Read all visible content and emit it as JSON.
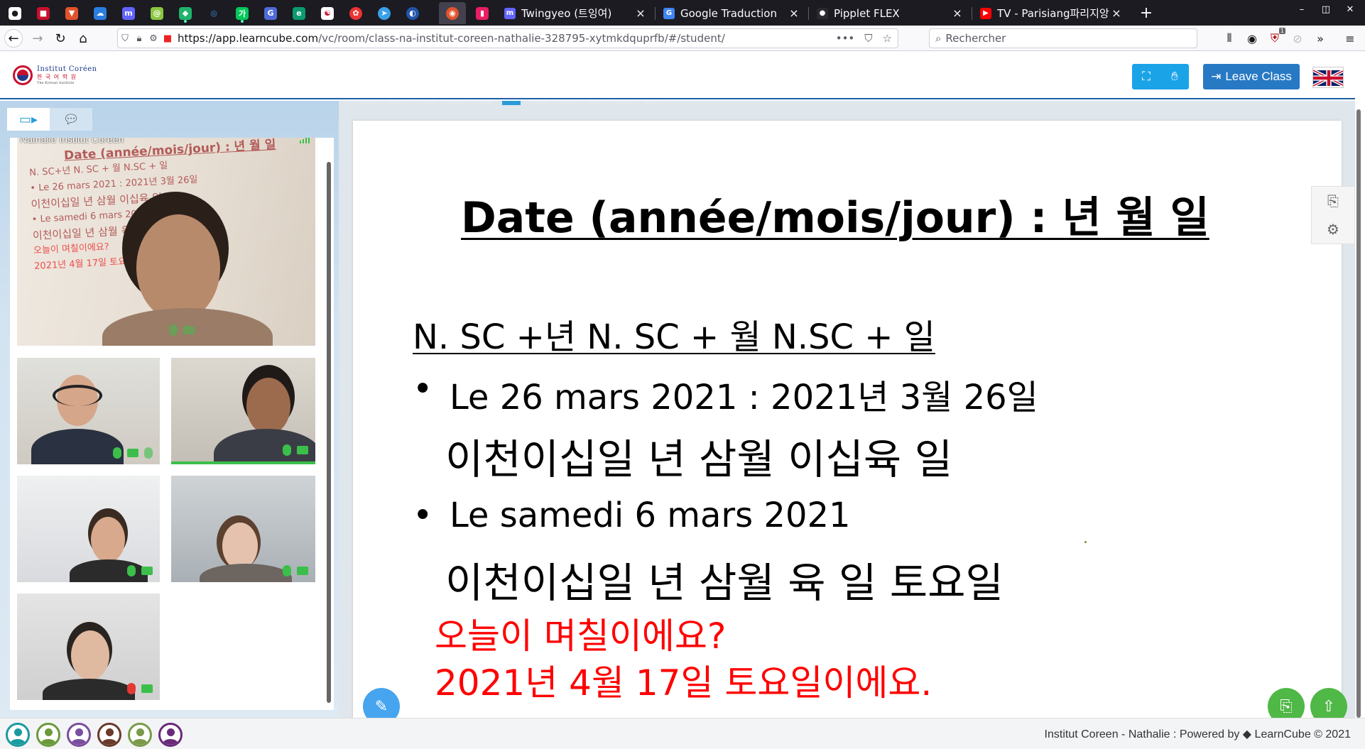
{
  "browser": {
    "tabs": [
      {
        "title": "Twingyeo (트잉여)",
        "icon": "mastodon-icon",
        "color": "#6364ff"
      },
      {
        "title": "Google Traduction",
        "icon": "google-translate-icon",
        "color": "#4285f4"
      },
      {
        "title": "Pipplet FLEX",
        "icon": "pipplet-icon",
        "color": "#2a2a2e"
      },
      {
        "title": "TV - Parisiang파리지앙 - Y",
        "icon": "youtube-icon",
        "color": "#ff0000"
      }
    ],
    "close_glyph": "×",
    "new_tab_glyph": "+",
    "url_host": "https://app.learncube.com",
    "url_path": "/vc/room/class-na-institut-coreen-nathalie-328795-xytmkdquprfb/#/student/",
    "search_placeholder": "Rechercher",
    "notification_badge": "1"
  },
  "app": {
    "logo_line1": "Institut Coréen",
    "logo_line2": "한 국 어 학 원",
    "logo_line3": "The Korean Institute",
    "leave_label": "Leave Class",
    "language_flag": "uk-flag-icon",
    "accent_color": "#1ba3e7",
    "brand_color": "#2779c4"
  },
  "sidebar": {
    "tabs": [
      {
        "name": "video-tab",
        "icon": "video-icon",
        "active": true
      },
      {
        "name": "chat-tab",
        "icon": "chat-icon",
        "active": false
      }
    ],
    "videos": [
      {
        "name": "Nathalie Institut Coreen",
        "role": "teacher"
      },
      {
        "name": "",
        "role": "student"
      },
      {
        "name": "",
        "role": "student",
        "speaking": true
      },
      {
        "name": "",
        "role": "student"
      },
      {
        "name": "",
        "role": "student"
      },
      {
        "name": "",
        "role": "student",
        "muted": true
      }
    ],
    "teacher_board": {
      "title": "Date (année/mois/jour) : 년 월 일",
      "line1": "N. SC+년 N. SC + 월 N.SC + 일",
      "line2": "• Le 26 mars 2021 : 2021년 3월 26일",
      "line3": "이천이십일 년 삼월 이십육 일",
      "line4": "• Le samedi 6 mars 2021",
      "line5": "이천이십일 년 삼월 육 일 토요일",
      "line6": "오늘이 며칠이에요?",
      "line7": "2021년 4월 17일 토요일이에요."
    }
  },
  "slide": {
    "title": "Date (année/mois/jour) : 년 월 일",
    "subtitle": "N. SC +년  N. SC + 월  N.SC + 일",
    "bullet1": "Le 26 mars 2021 : 2021년 3월 26일",
    "korean1": "이천이십일 년 삼월 이십육 일",
    "bullet2": "Le samedi 6 mars 2021",
    "korean2": "이천이십일 년 삼월 육 일 토요일",
    "question": "오늘이 며칠이에요?",
    "answer": "2021년 4월 17일 토요일이에요.",
    "answer_color": "#ff0000"
  },
  "footer": {
    "participant_count": 6,
    "text_prefix": "Institut Coreen - Nathalie : ",
    "powered_by": "Powered by ",
    "brand": "LearnCube © 2021"
  }
}
